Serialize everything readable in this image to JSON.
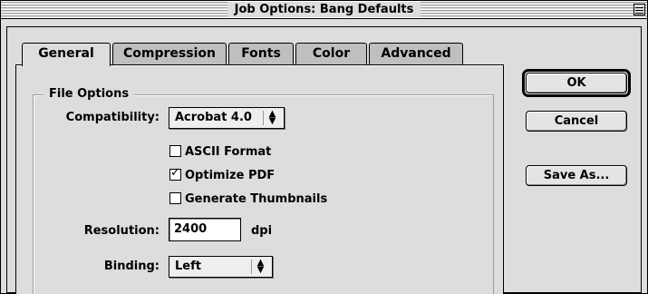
{
  "window": {
    "title": "Job Options: Bang Defaults"
  },
  "tabs": [
    {
      "label": "General",
      "selected": true
    },
    {
      "label": "Compression",
      "selected": false
    },
    {
      "label": "Fonts",
      "selected": false
    },
    {
      "label": "Color",
      "selected": false
    },
    {
      "label": "Advanced",
      "selected": false
    }
  ],
  "file_options": {
    "group_title": "File Options",
    "compatibility_label": "Compatibility:",
    "compatibility_value": "Acrobat 4.0",
    "checkboxes": [
      {
        "label": "ASCII Format",
        "checked": false
      },
      {
        "label": "Optimize PDF",
        "checked": true
      },
      {
        "label": "Generate Thumbnails",
        "checked": false
      }
    ],
    "resolution_label": "Resolution:",
    "resolution_value": "2400",
    "resolution_unit": "dpi",
    "binding_label": "Binding:",
    "binding_value": "Left"
  },
  "buttons": {
    "ok": "OK",
    "cancel": "Cancel",
    "save_as": "Save As..."
  }
}
